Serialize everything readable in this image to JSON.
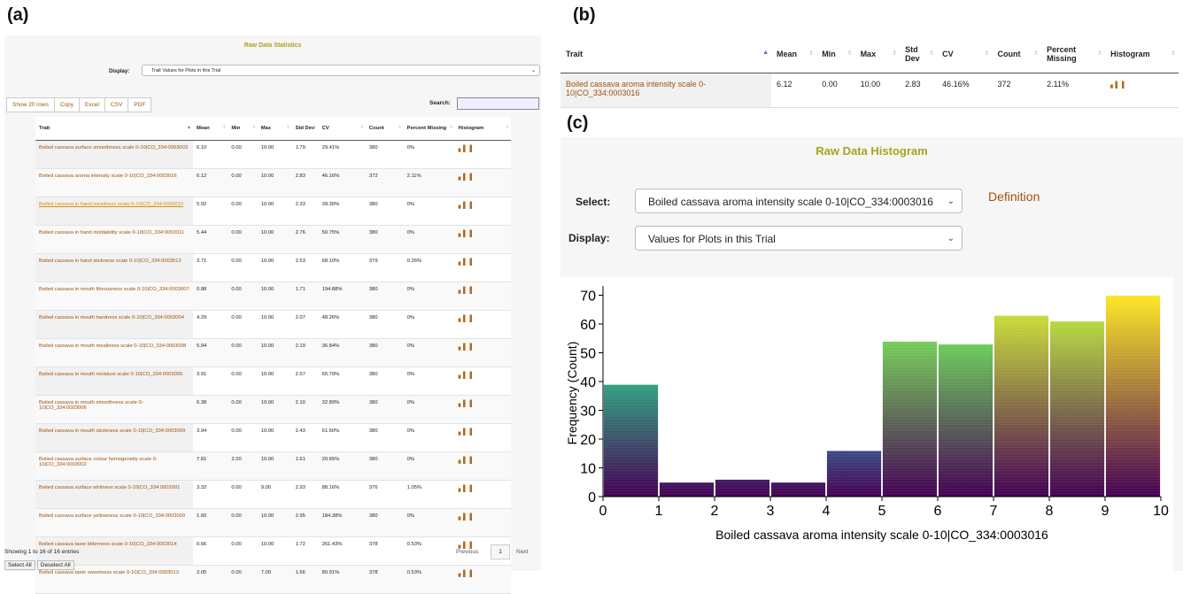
{
  "panel_labels": {
    "a": "(a)",
    "b": "(b)",
    "c": "(c)"
  },
  "panelA": {
    "title": "Raw Data Statistics",
    "display_label": "Display:",
    "display_value": "Trait Values for Plots in this Trial",
    "buttons": [
      "Show 20 rows",
      "Copy",
      "Excel",
      "CSV",
      "PDF"
    ],
    "search_label": "Search:",
    "headers": [
      "Trait",
      "Mean",
      "Min",
      "Max",
      "Std Dev",
      "CV",
      "Count",
      "Percent Missing",
      "Histogram"
    ],
    "rows": [
      {
        "trait": "Boiled cassava surface smoothness scale 0-10|CO_334:0003003",
        "mean": "6.10",
        "min": "0.00",
        "max": "10.00",
        "std": "1.79",
        "cv": "29.41%",
        "count": "380",
        "missing": "0%"
      },
      {
        "trait": "Boiled cassava aroma intensity scale 0-10|CO_334:0003016",
        "mean": "6.12",
        "min": "0.00",
        "max": "10.00",
        "std": "2.83",
        "cv": "46.16%",
        "count": "372",
        "missing": "2.11%"
      },
      {
        "trait": "Boiled cassava in hand mealiness scale 0-10|CO_334:0003010",
        "mean": "5.92",
        "min": "0.00",
        "max": "10.00",
        "std": "2.33",
        "cv": "39.30%",
        "count": "380",
        "missing": "0%"
      },
      {
        "trait": "Boiled cassava in hand moldability scale 0-10|CO_334:0003011",
        "mean": "5.44",
        "min": "0.00",
        "max": "10.00",
        "std": "2.76",
        "cv": "50.75%",
        "count": "380",
        "missing": "0%"
      },
      {
        "trait": "Boiled cassava in hand stickness scale 0-10|CO_334:0003012",
        "mean": "3.71",
        "min": "0.00",
        "max": "10.00",
        "std": "2.53",
        "cv": "68.10%",
        "count": "379",
        "missing": "0.26%"
      },
      {
        "trait": "Boiled cassava in mouth fibrousness scale 0-10|CO_334:0003007",
        "mean": "0.88",
        "min": "0.00",
        "max": "10.00",
        "std": "1.71",
        "cv": "194.88%",
        "count": "380",
        "missing": "0%"
      },
      {
        "trait": "Boiled cassava in mouth hardness scale 0-10|CO_334:0003004",
        "mean": "4.29",
        "min": "0.00",
        "max": "10.00",
        "std": "2.07",
        "cv": "48.26%",
        "count": "380",
        "missing": "0%"
      },
      {
        "trait": "Boiled cassava in mouth mealiness scale 0-10|CO_334:0003008",
        "mean": "5.94",
        "min": "0.00",
        "max": "10.00",
        "std": "2.19",
        "cv": "36.84%",
        "count": "380",
        "missing": "0%"
      },
      {
        "trait": "Boiled cassava in mouth moisture scale 0-10|CO_334:0003005",
        "mean": "3.91",
        "min": "0.00",
        "max": "10.00",
        "std": "2.57",
        "cv": "65.79%",
        "count": "380",
        "missing": "0%"
      },
      {
        "trait": "Boiled cassava in mouth smoothness scale 0-10|CO_334:0003006",
        "mean": "6.38",
        "min": "0.00",
        "max": "10.00",
        "std": "2.10",
        "cv": "32.89%",
        "count": "380",
        "missing": "0%"
      },
      {
        "trait": "Boiled cassava in mouth stickiness scale 0-10|CO_334:0003009",
        "mean": "3.94",
        "min": "0.00",
        "max": "10.00",
        "std": "2.43",
        "cv": "61.60%",
        "count": "380",
        "missing": "0%"
      },
      {
        "trait": "Boiled cassava surface colour homogeneity scale 0-10|CO_334:0003002",
        "mean": "7.81",
        "min": "2.00",
        "max": "10.00",
        "std": "1.61",
        "cv": "20.65%",
        "count": "380",
        "missing": "0%"
      },
      {
        "trait": "Boiled cassava surface whitness scale 0-10|CO_334:0003001",
        "mean": "3.32",
        "min": "0.00",
        "max": "9.00",
        "std": "2.93",
        "cv": "88.16%",
        "count": "376",
        "missing": "1.05%"
      },
      {
        "trait": "Boiled cassava surface yellowness scale 0-10|CO_334:0003000",
        "mean": "1.60",
        "min": "0.00",
        "max": "10.00",
        "std": "2.95",
        "cv": "184.38%",
        "count": "380",
        "missing": "0%"
      },
      {
        "trait": "Boiled cassava taste bitterness scale 0-10|CO_334:0003014",
        "mean": "0.66",
        "min": "0.00",
        "max": "10.00",
        "std": "1.72",
        "cv": "261.43%",
        "count": "378",
        "missing": "0.53%"
      },
      {
        "trait": "Boiled cassava taste sweetness scale 0-10|CO_334:0003013",
        "mean": "2.05",
        "min": "0.00",
        "max": "7.00",
        "std": "1.66",
        "cv": "80.91%",
        "count": "378",
        "missing": "0.53%"
      }
    ],
    "showing": "Showing 1 to 16 of 16 entries",
    "previous": "Previous",
    "page": "1",
    "next": "Next",
    "select_all": "Select All",
    "deselect_all": "Deselect All"
  },
  "panelB": {
    "headers": [
      "Trait",
      "Mean",
      "Min",
      "Max",
      "Std Dev",
      "CV",
      "Count",
      "Percent Missing",
      "Histogram"
    ],
    "row": {
      "trait": "Boiled cassava aroma intensity scale 0-10|CO_334:0003016",
      "mean": "6.12",
      "min": "0.00",
      "max": "10.00",
      "std": "2.83",
      "cv": "46.16%",
      "count": "372",
      "missing": "2.11%"
    }
  },
  "panelC": {
    "title": "Raw Data Histogram",
    "select_label": "Select:",
    "select_value": "Boiled cassava aroma intensity scale 0-10|CO_334:0003016",
    "definition": "Definition",
    "display_label": "Display:",
    "display_value": "Values for Plots in this Trial"
  },
  "icons": {
    "histogram": "bar-chart-icon",
    "chevron": "chevron-down-icon",
    "sort": "sort-icon"
  },
  "colors": {
    "title": "#a5a51a",
    "link": "#a0520a",
    "accent_sort": "#5568d0"
  },
  "chart_data": {
    "type": "bar",
    "bins": [
      [
        0,
        1
      ],
      [
        1,
        2
      ],
      [
        2,
        3
      ],
      [
        3,
        4
      ],
      [
        4,
        5
      ],
      [
        5,
        6
      ],
      [
        6,
        7
      ],
      [
        7,
        8
      ],
      [
        8,
        9
      ],
      [
        9,
        10
      ]
    ],
    "values": [
      39,
      5,
      6,
      5,
      16,
      54,
      53,
      63,
      61,
      70
    ],
    "xlabel": "Boiled cassava aroma intensity scale 0-10|CO_334:0003016",
    "ylabel": "Frequency (Count)",
    "xticks": [
      "0",
      "1",
      "2",
      "3",
      "4",
      "5",
      "6",
      "7",
      "8",
      "9",
      "10"
    ],
    "yticks": [
      "0",
      "10",
      "20",
      "30",
      "40",
      "50",
      "60",
      "70"
    ],
    "xlim": [
      0,
      10
    ],
    "ylim": [
      0,
      72
    ],
    "colormap": "viridis"
  }
}
